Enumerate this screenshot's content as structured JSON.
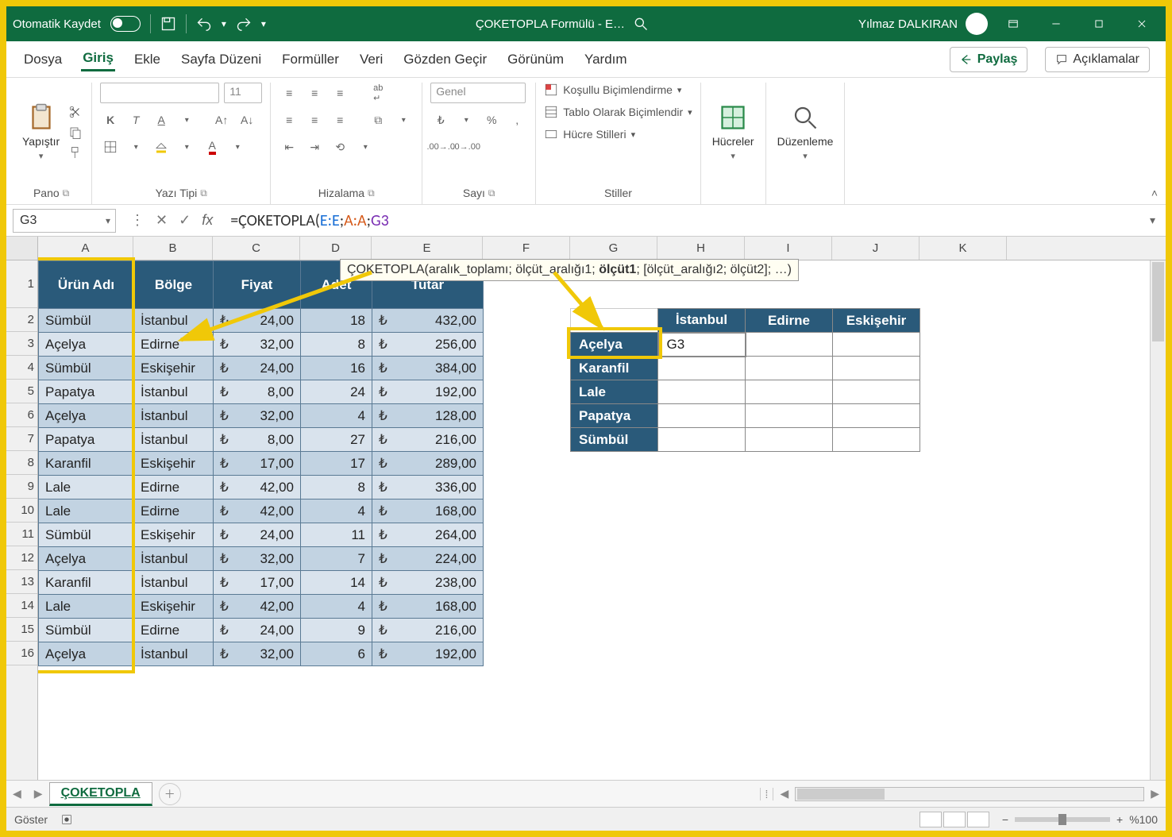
{
  "titlebar": {
    "autosave": "Otomatik Kaydet",
    "filename": "ÇOKETOPLA Formülü  -  E…",
    "username": "Yılmaz DALKIRAN"
  },
  "tabs": {
    "items": [
      "Dosya",
      "Giriş",
      "Ekle",
      "Sayfa Düzeni",
      "Formüller",
      "Veri",
      "Gözden Geçir",
      "Görünüm",
      "Yardım"
    ],
    "active": 1,
    "share": "Paylaş",
    "comments": "Açıklamalar"
  },
  "ribbon": {
    "paste": "Yapıştır",
    "clipboard": "Pano",
    "font": "Yazı Tipi",
    "fontSize": "11",
    "align": "Hizalama",
    "number": "Sayı",
    "numberFormat": "Genel",
    "styles": "Stiller",
    "conditional": "Koşullu Biçimlendirme",
    "tableFormat": "Tablo Olarak Biçimlendir",
    "cellStyles": "Hücre Stilleri",
    "cells": "Hücreler",
    "editing": "Düzenleme"
  },
  "namebox": "G3",
  "formula": {
    "prefix": "=ÇOKETOPLA(",
    "ref1": "E:E",
    "ref2": "A:A",
    "ref3": "G3"
  },
  "tooltip": {
    "fn": "ÇOKETOPLA",
    "args": "(aralık_toplamı; ölçüt_aralığı1; ",
    "bold": "ölçüt1",
    "rest": "; [ölçüt_aralığı2; ölçüt2]; …)"
  },
  "columns": [
    "A",
    "B",
    "C",
    "D",
    "E",
    "F",
    "G",
    "H",
    "I",
    "J",
    "K"
  ],
  "mainTable": {
    "headers": [
      "Ürün Adı",
      "Bölge",
      "Fiyat",
      "Adet",
      "Tutar"
    ],
    "rows": [
      [
        "Sümbül",
        "İstanbul",
        "24,00",
        "18",
        "432,00"
      ],
      [
        "Açelya",
        "Edirne",
        "32,00",
        "8",
        "256,00"
      ],
      [
        "Sümbül",
        "Eskişehir",
        "24,00",
        "16",
        "384,00"
      ],
      [
        "Papatya",
        "İstanbul",
        "8,00",
        "24",
        "192,00"
      ],
      [
        "Açelya",
        "İstanbul",
        "32,00",
        "4",
        "128,00"
      ],
      [
        "Papatya",
        "İstanbul",
        "8,00",
        "27",
        "216,00"
      ],
      [
        "Karanfil",
        "Eskişehir",
        "17,00",
        "17",
        "289,00"
      ],
      [
        "Lale",
        "Edirne",
        "42,00",
        "8",
        "336,00"
      ],
      [
        "Lale",
        "Edirne",
        "42,00",
        "4",
        "168,00"
      ],
      [
        "Sümbül",
        "Eskişehir",
        "24,00",
        "11",
        "264,00"
      ],
      [
        "Açelya",
        "İstanbul",
        "32,00",
        "7",
        "224,00"
      ],
      [
        "Karanfil",
        "İstanbul",
        "17,00",
        "14",
        "238,00"
      ],
      [
        "Lale",
        "Eskişehir",
        "42,00",
        "4",
        "168,00"
      ],
      [
        "Sümbül",
        "Edirne",
        "24,00",
        "9",
        "216,00"
      ],
      [
        "Açelya",
        "İstanbul",
        "32,00",
        "6",
        "192,00"
      ]
    ]
  },
  "pivot": {
    "colHeaders": [
      "İstanbul",
      "Edirne",
      "Eskişehir"
    ],
    "rowHeaders": [
      "Açelya",
      "Karanfil",
      "Lale",
      "Papatya",
      "Sümbül"
    ],
    "editingCell": "G3"
  },
  "sheetTab": "ÇOKETOPLA",
  "status": {
    "mode": "Göster",
    "zoom": "%100"
  }
}
